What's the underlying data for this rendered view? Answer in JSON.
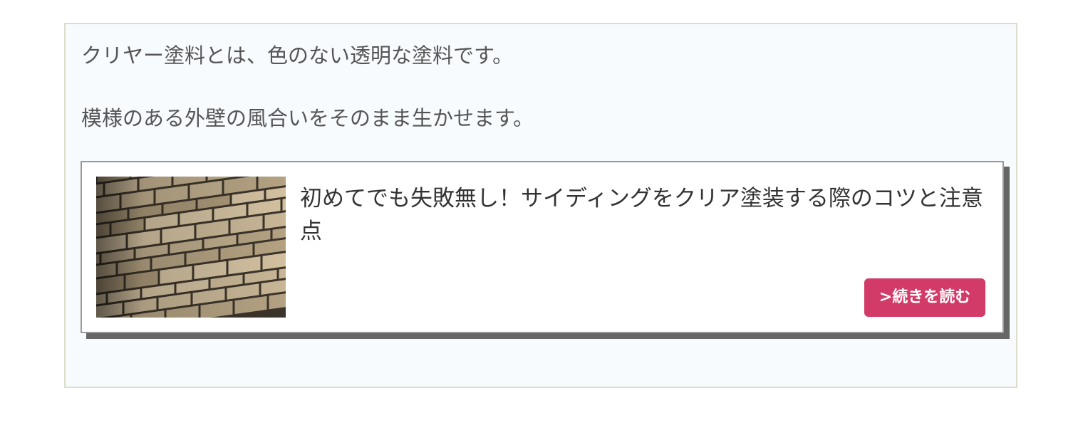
{
  "content": {
    "paragraph_1": "クリヤー塗料とは、色のない透明な塗料です。",
    "paragraph_2": "模様のある外壁の風合いをそのまま生かせます。"
  },
  "link_card": {
    "image_icon": "brick-siding-wall-photo",
    "title": "初めてでも失敗無し！サイディングをクリア塗装する際のコツと注意点",
    "read_more_label": ">続きを読む"
  },
  "colors": {
    "box_background": "#f7fbfe",
    "box_border": "#ddddcc",
    "button_accent": "#d23a67",
    "card_shadow": "#666666"
  }
}
